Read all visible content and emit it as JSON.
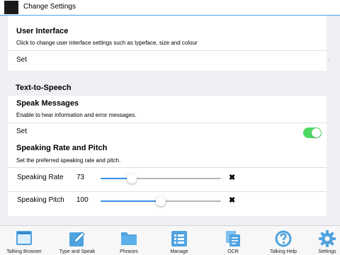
{
  "header": {
    "title": "Change Settings"
  },
  "user_interface": {
    "heading": "User Interface",
    "description": "Click to change user interface settings such as typeface, size and colour",
    "row_label": "Set",
    "chevron": "›"
  },
  "tts": {
    "section_title": "Text-to-Speech",
    "speak_messages": {
      "heading": "Speak Messages",
      "description": "Enable to hear information and error messages.",
      "row_label": "Set",
      "enabled": true
    },
    "rate_pitch": {
      "heading": "Speaking Rate and Pitch",
      "description": "Set the preferred speaking rate and pitch.",
      "rate": {
        "label": "Speaking Rate",
        "value": "73",
        "level": 0.26
      },
      "pitch": {
        "label": "Speaking Pitch",
        "value": "100",
        "level": 0.5
      },
      "reset_glyph": "✖"
    }
  },
  "tabbar": {
    "tabs": [
      {
        "label": "Talking Browser",
        "icon": "browser-window-icon"
      },
      {
        "label": "Type and Speak",
        "icon": "pencil-square-icon"
      },
      {
        "label": "Phrases",
        "icon": "folder-icon"
      },
      {
        "label": "Manage",
        "icon": "list-icon"
      },
      {
        "label": "OCR",
        "icon": "ocr-documents-icon"
      },
      {
        "label": "Talking Help",
        "icon": "question-circle-icon"
      },
      {
        "label": "Settings",
        "icon": "gear-icon"
      }
    ]
  },
  "colors": {
    "accent": "#3a8ee6",
    "toggle_on": "#4cd964",
    "icon_blue": "#4fa3e0"
  }
}
